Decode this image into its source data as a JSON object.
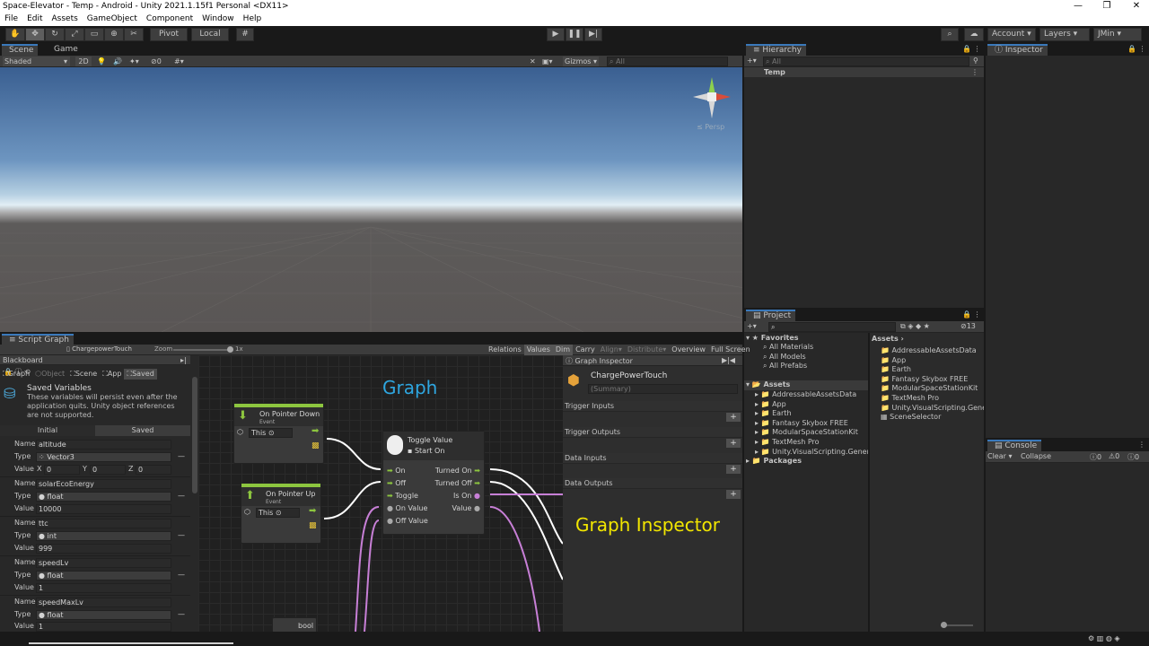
{
  "window": {
    "title": "Space-Elevator - Temp - Android - Unity 2021.1.15f1 Personal <DX11>",
    "min": "—",
    "max": "❐",
    "close": "✕"
  },
  "menu": [
    "File",
    "Edit",
    "Assets",
    "GameObject",
    "Component",
    "Window",
    "Help"
  ],
  "toolbar": {
    "pivot": "Pivot",
    "local": "Local",
    "account": "Account",
    "layers": "Layers",
    "user": "JMin"
  },
  "scene": {
    "tab_scene": "Scene",
    "tab_game": "Game",
    "shade": "Shaded",
    "mode2d": "2D",
    "fx_count": "0",
    "gizmos": "Gizmos",
    "search": "All",
    "persp": "≤ Persp"
  },
  "hierarchy": {
    "title": "Hierarchy",
    "search": "All",
    "root": "Temp"
  },
  "inspector": {
    "title": "Inspector"
  },
  "project": {
    "title": "Project",
    "count": "13",
    "favorites": "Favorites",
    "fav_items": [
      "All Materials",
      "All Models",
      "All Prefabs"
    ],
    "assets": "Assets",
    "asset_items": [
      "AddressableAssetsData",
      "App",
      "Earth",
      "Fantasy Skybox FREE",
      "ModularSpaceStationKit",
      "TextMesh Pro",
      "Unity.VisualScripting.Genera"
    ],
    "packages": "Packages",
    "crumb": "Assets",
    "files": [
      "AddressableAssetsData",
      "App",
      "Earth",
      "Fantasy Skybox FREE",
      "ModularSpaceStationKit",
      "TextMesh Pro",
      "Unity.VisualScripting.Genera",
      "SceneSelector"
    ]
  },
  "console": {
    "title": "Console",
    "clear": "Clear",
    "collapse": "Collapse",
    "c1": "0",
    "c2": "0",
    "c3": "0"
  },
  "script_graph": {
    "title": "Script Graph",
    "asset": "ChargepowerTouch",
    "zoom": "Zoom",
    "zoom_val": "1x",
    "tools": [
      "Relations",
      "Values",
      "Dim",
      "Carry",
      "Align",
      "Distribute",
      "Overview",
      "Full Screen"
    ]
  },
  "blackboard": {
    "title": "Blackboard",
    "tabs": [
      "Graph",
      "Object",
      "Scene",
      "App",
      "Saved"
    ],
    "saved_title": "Saved Variables",
    "saved_desc": "These variables will persist even after the application quits. Unity object references are not supported.",
    "col_initial": "Initial",
    "col_saved": "Saved",
    "name_lbl": "Name",
    "type_lbl": "Type",
    "value_lbl": "Value",
    "vars": [
      {
        "name": "altitude",
        "type": "Vector3",
        "x": "0",
        "y": "0",
        "z": "0"
      },
      {
        "name": "solarEcoEnergy",
        "type": "float",
        "value": "10000"
      },
      {
        "name": "ttc",
        "type": "int",
        "value": "999"
      },
      {
        "name": "speedLv",
        "type": "float",
        "value": "1"
      },
      {
        "name": "speedMaxLv",
        "type": "float",
        "value": "1"
      }
    ]
  },
  "graph": {
    "label": "Graph",
    "inspector_label": "Graph Inspector",
    "down": {
      "title": "On Pointer Down",
      "sub": "Event",
      "this": "This"
    },
    "up": {
      "title": "On Pointer Up",
      "sub": "Event",
      "this": "This"
    },
    "toggle": {
      "title": "Toggle Value",
      "start": "Start On",
      "in": [
        "On",
        "Off",
        "Toggle",
        "On Value",
        "Off Value"
      ],
      "out": [
        "Turned On",
        "Turned Off",
        "Is On",
        "Value"
      ]
    },
    "bool": "bool"
  },
  "graph_inspector": {
    "title": "Graph Inspector",
    "name": "ChargePowerTouch",
    "summary": "(Summary)",
    "sections": [
      "Trigger Inputs",
      "Trigger Outputs",
      "Data Inputs",
      "Data Outputs"
    ],
    "add": "+"
  }
}
